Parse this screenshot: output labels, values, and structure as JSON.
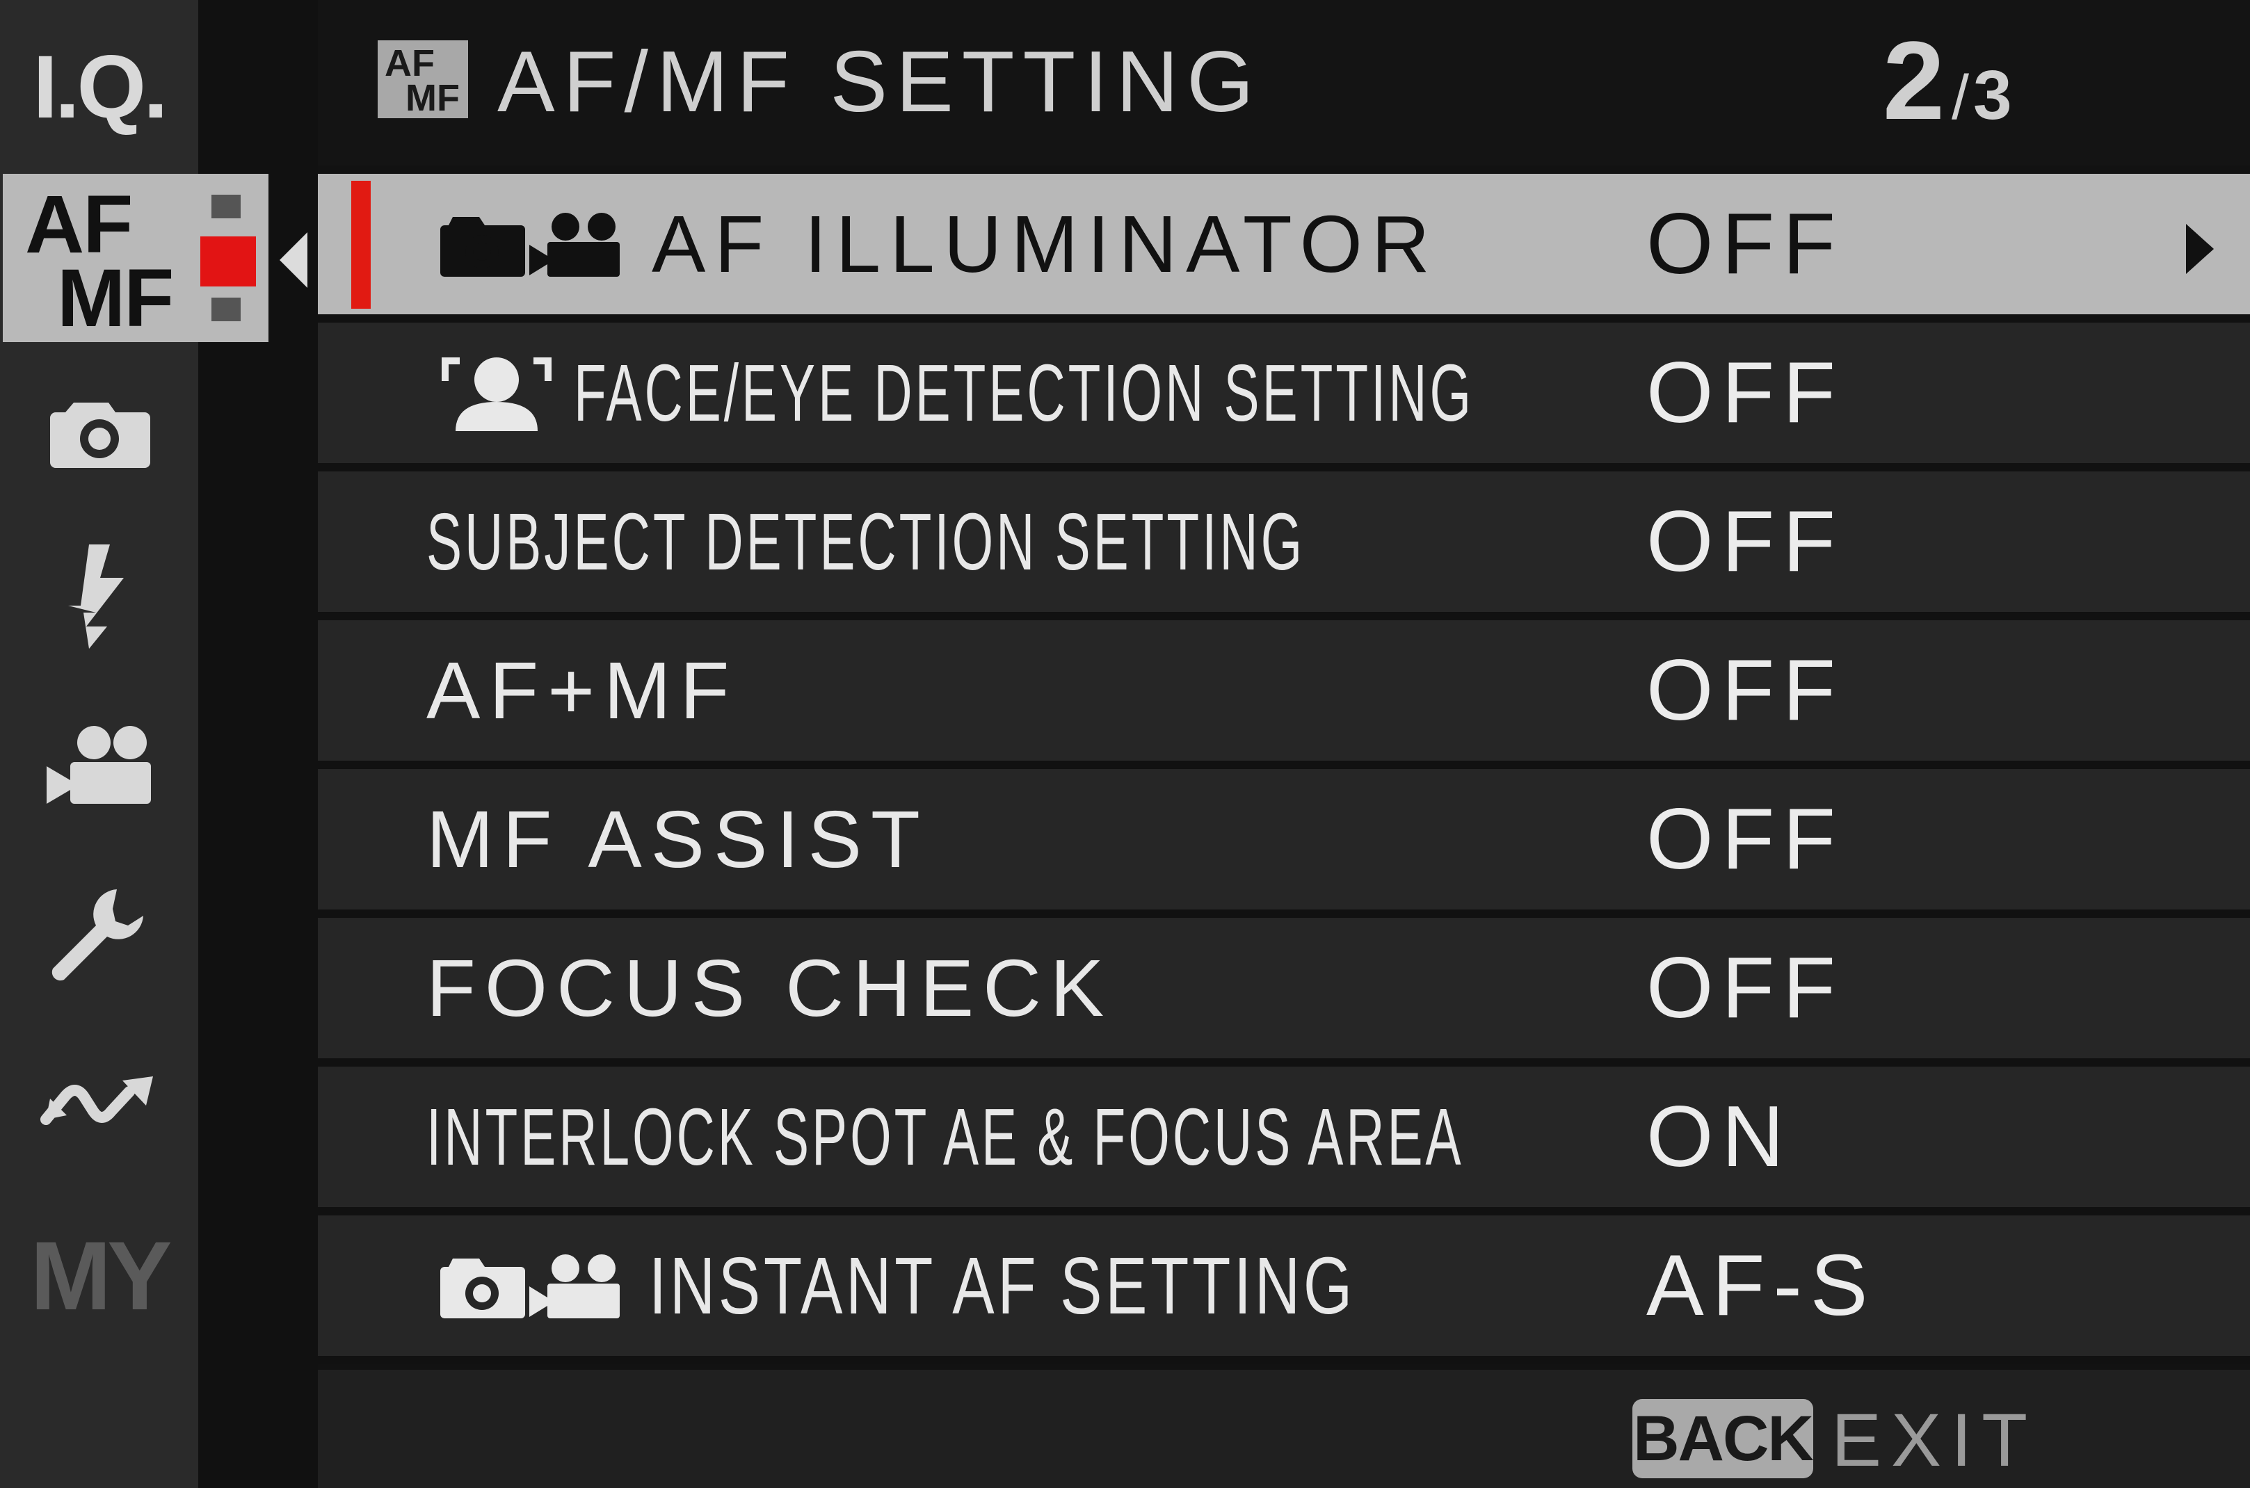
{
  "sidebar": {
    "tabs": [
      {
        "id": "iq",
        "label": "I.Q."
      },
      {
        "id": "afmf",
        "label_top": "AF",
        "label_bottom": "MF",
        "selected": true
      },
      {
        "id": "shooting",
        "icon": "camera-icon"
      },
      {
        "id": "flash",
        "icon": "flash-icon"
      },
      {
        "id": "movie",
        "icon": "movie-camera-icon"
      },
      {
        "id": "setup",
        "icon": "wrench-icon"
      },
      {
        "id": "playback",
        "icon": "wave-arrow-icon"
      },
      {
        "id": "my_menu",
        "label": "MY"
      }
    ]
  },
  "header": {
    "icon_top": "AF",
    "icon_bottom": "MF",
    "title": "AF/MF SETTING",
    "page_current": "2",
    "page_separator": "/",
    "page_total": "3"
  },
  "menu": {
    "items": [
      {
        "label": "AF ILLUMINATOR",
        "value": "OFF",
        "icon": "still-and-movie-icon",
        "selected": true
      },
      {
        "label": "FACE/EYE DETECTION SETTING",
        "value": "OFF",
        "icon": "face-detection-icon"
      },
      {
        "label": "SUBJECT DETECTION SETTING",
        "value": "OFF"
      },
      {
        "label": "AF+MF",
        "value": "OFF"
      },
      {
        "label": "MF ASSIST",
        "value": "OFF"
      },
      {
        "label": "FOCUS CHECK",
        "value": "OFF"
      },
      {
        "label": "INTERLOCK SPOT AE & FOCUS AREA",
        "value": "ON"
      },
      {
        "label": "INSTANT AF SETTING",
        "value": "AF-S",
        "icon": "still-and-movie-icon"
      }
    ]
  },
  "footer": {
    "back_label": "BACK",
    "exit_label": "EXIT"
  },
  "colors": {
    "accent_red": "#e11a12",
    "selected_row": "#b8b8b8",
    "row_bg": "#262626",
    "background": "#121212"
  }
}
